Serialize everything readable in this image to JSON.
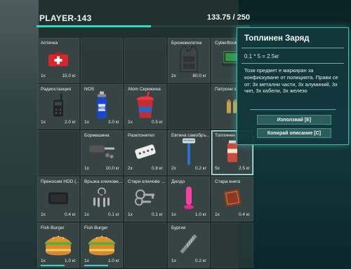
{
  "header": {
    "player": "PLAYER-143",
    "weight_text": "133.75 / 250",
    "weight_fraction": 0.535
  },
  "colors": {
    "accent": "#2fd8c8",
    "panel": "#12383c"
  },
  "slots": [
    {
      "name": "Аптечка",
      "qty": "1x",
      "weight": "15.0 кг",
      "icon": "first-aid-kit-icon"
    },
    {
      "name": "",
      "empty": true
    },
    {
      "name": "",
      "empty": true
    },
    {
      "name": "Бронежилетка",
      "qty": "2x",
      "weight": "80.0 кг",
      "icon": "body-armor-icon"
    },
    {
      "name": "CyberBook",
      "qty": "",
      "weight": "",
      "icon": "laptop-icon"
    },
    {
      "name": "Радиостанция",
      "qty": "1x",
      "weight": "2.0 кг",
      "icon": "radio-icon"
    },
    {
      "name": "NOS",
      "qty": "1x",
      "weight": "3.0 кг",
      "icon": "nos-bottle-icon"
    },
    {
      "name": "Atom Скрежина",
      "qty": "1x",
      "weight": "0.5 кг",
      "icon": "slush-cup-icon"
    },
    {
      "name": "",
      "empty": true
    },
    {
      "name": "Патрони з",
      "qty": "",
      "weight": "",
      "icon": "ammo-icon"
    },
    {
      "name": "",
      "empty": true
    },
    {
      "name": "Бормашина",
      "qty": "1x",
      "weight": "10.0 кг",
      "icon": "drill-icon"
    },
    {
      "name": "Разклонител",
      "qty": "2x",
      "weight": "0.8 кг",
      "icon": "power-strip-icon"
    },
    {
      "name": "Евтина самобръ...",
      "qty": "2x",
      "weight": "0.2 кг",
      "icon": "razor-icon"
    },
    {
      "name": "Топлинен Заряд",
      "qty": "5x",
      "weight": "2.5 кг",
      "icon": "thermal-charge-icon",
      "selected": true
    },
    {
      "name": "Преносим HDD (...",
      "qty": "1x",
      "weight": "0.4 кг",
      "icon": "hdd-icon"
    },
    {
      "name": "Връзка ключове...",
      "qty": "1x",
      "weight": "0.1 кг",
      "icon": "keys-icon"
    },
    {
      "name": "Стари ключове ...",
      "qty": "1x",
      "weight": "0.1 кг",
      "icon": "old-keys-icon"
    },
    {
      "name": "Дилдо",
      "qty": "1x",
      "weight": "1.0 кг",
      "icon": "pink-toy-icon"
    },
    {
      "name": "Стара книга",
      "qty": "1x",
      "weight": "0.4 кг",
      "icon": "book-icon"
    },
    {
      "name": "Fish Burger",
      "qty": "1x",
      "weight": "1.0 кг",
      "icon": "burger-icon",
      "durability": 0.65
    },
    {
      "name": "Fish Burger",
      "qty": "1x",
      "weight": "1.0 кг",
      "icon": "burger-icon",
      "durability": 0.65
    },
    {
      "name": "",
      "empty": true
    },
    {
      "name": "Бургия",
      "qty": "1x",
      "weight": "0.2 кг",
      "icon": "drill-bit-icon"
    },
    {
      "name": "",
      "empty": true
    }
  ],
  "tooltip": {
    "title": "Топлинен Заряд",
    "formula": "0.1 * 5 = 2.5кг",
    "description": "Този предмет е маркиран за конфискуване от полицията. Прави се от: 3х метални части, 3х алуминий, 3х чип, 3х кабели, 3х железо",
    "use_label": "Използвай [E]",
    "copy_label": "Копирай описание [C]"
  }
}
